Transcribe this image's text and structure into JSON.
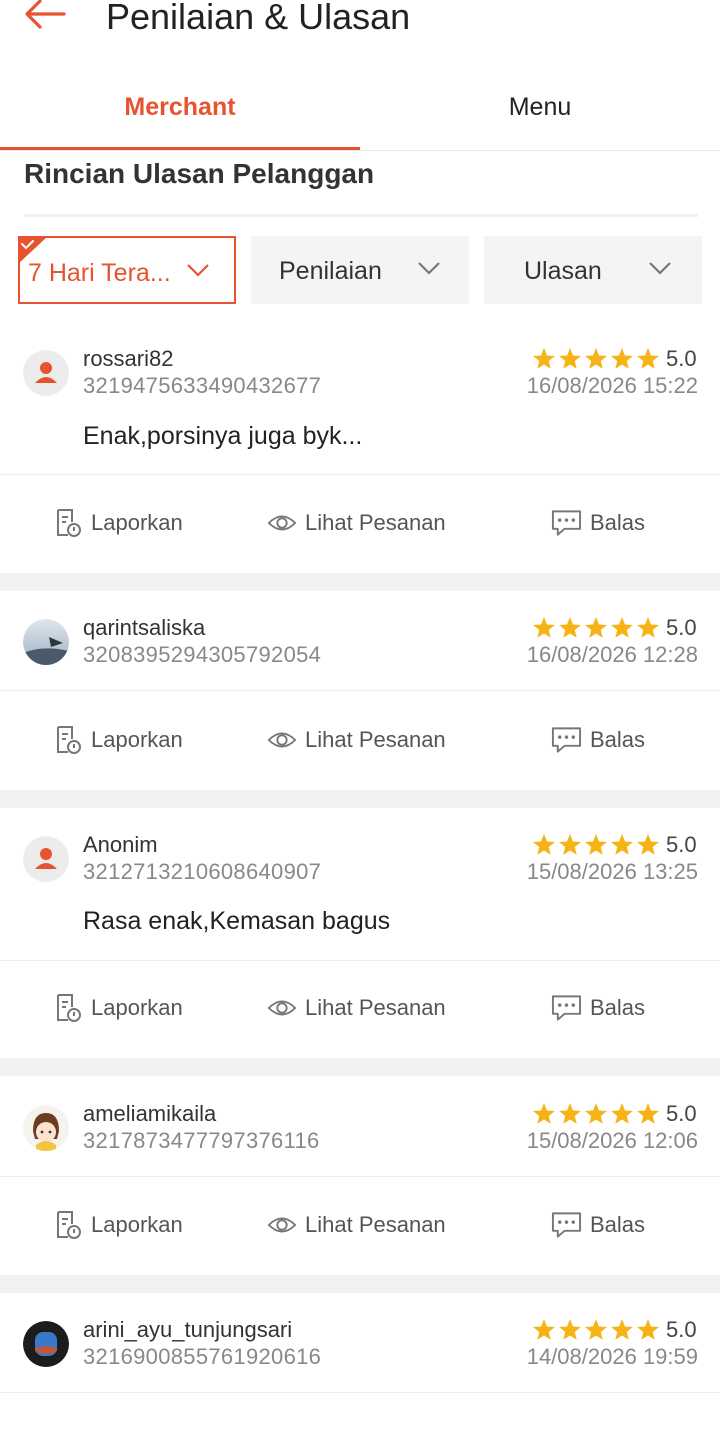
{
  "header": {
    "title": "Penilaian & Ulasan"
  },
  "tabs": [
    {
      "label": "Merchant"
    },
    {
      "label": "Menu"
    }
  ],
  "section": {
    "title": "Rincian Ulasan Pelanggan"
  },
  "filters": [
    {
      "label": "7 Hari Tera..."
    },
    {
      "label": "Penilaian"
    },
    {
      "label": "Ulasan"
    }
  ],
  "actions": {
    "report": "Laporkan",
    "view_order": "Lihat Pesanan",
    "reply": "Balas"
  },
  "colors": {
    "accent": "#e8532f",
    "star": "#f5b316"
  },
  "reviews": [
    {
      "username": "rossari82",
      "order_id": "3219475633490432677",
      "rating": "5.0",
      "date": "16/08/2026 15:22",
      "comment": "Enak,porsinya juga byk..."
    },
    {
      "username": "qarintsaliska",
      "order_id": "3208395294305792054",
      "rating": "5.0",
      "date": "16/08/2026 12:28",
      "comment": ""
    },
    {
      "username": "Anonim",
      "order_id": "3212713210608640907",
      "rating": "5.0",
      "date": "15/08/2026 13:25",
      "comment": "Rasa enak,Kemasan bagus"
    },
    {
      "username": "ameliamikaila",
      "order_id": "3217873477797376116",
      "rating": "5.0",
      "date": "15/08/2026 12:06",
      "comment": ""
    },
    {
      "username": "arini_ayu_tunjungsari",
      "order_id": "3216900855761920616",
      "rating": "5.0",
      "date": "14/08/2026 19:59",
      "comment": ""
    }
  ]
}
